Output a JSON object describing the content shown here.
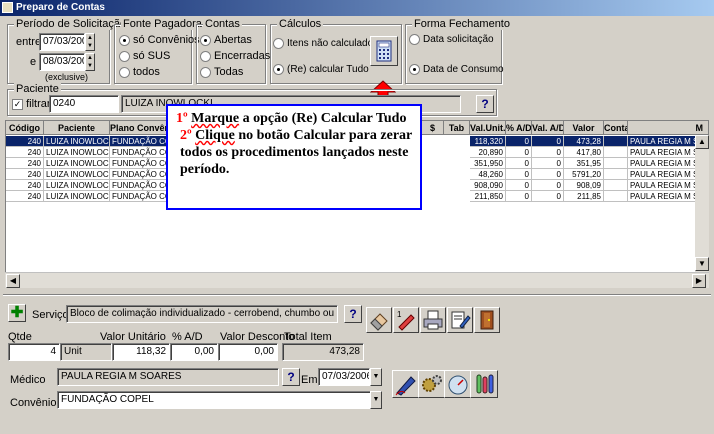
{
  "window": {
    "title": "Preparo de Contas"
  },
  "periodo": {
    "label": "Período de Solicitação",
    "entre_label": "entre",
    "entre_value": "07/03/2006",
    "e_label": "e",
    "e_value": "08/03/2006",
    "exclusive": "(exclusive)"
  },
  "fonte": {
    "label": "Fonte Pagadora",
    "options": [
      "só Convênios",
      "só SUS",
      "todos"
    ],
    "selected": 0
  },
  "contas": {
    "label": "Contas",
    "options": [
      "Abertas",
      "Encerradas",
      "Todas"
    ],
    "selected": 0
  },
  "calculos": {
    "label": "Cálculos",
    "options": [
      "Itens não calculados",
      "(Re) calcular Tudo"
    ],
    "selected": 1
  },
  "fechamento": {
    "label": "Forma Fechamento",
    "options": [
      "Data solicitação",
      "Data de Consumo"
    ],
    "selected": 1
  },
  "paciente": {
    "label": "Paciente",
    "filtrar_label": "filtrar",
    "code": "0240",
    "name": "LUIZA INOWLOCKI",
    "help": "?"
  },
  "grid": {
    "columns": [
      "Código",
      "Paciente",
      "Plano Convênio",
      "$",
      "Tab",
      "Val.Unit.",
      "% A/D",
      "Val. A/D.",
      "Valor",
      "Conta",
      "M"
    ],
    "rows": [
      [
        "240",
        "LUIZA INOWLOCKI",
        "FUNDAÇÃO COPEL",
        "118,320",
        "0",
        "0",
        "473,28",
        "PAULA REGIA M SOARES"
      ],
      [
        "240",
        "LUIZA INOWLOCKI",
        "FUNDAÇÃO COPEL",
        "20,890",
        "0",
        "0",
        "417,80",
        "PAULA REGIA M SOARES"
      ],
      [
        "240",
        "LUIZA INOWLOCKI",
        "FUNDAÇÃO COPEL",
        "351,950",
        "0",
        "0",
        "351,95",
        "PAULA REGIA M SOARES"
      ],
      [
        "240",
        "LUIZA INOWLOCKI",
        "FUNDAÇÃO COPEL",
        "48,260",
        "0",
        "0",
        "5791,20",
        "PAULA REGIA M SOARES"
      ],
      [
        "240",
        "LUIZA INOWLOCKI",
        "FUNDAÇÃO COPEL",
        "908,090",
        "0",
        "0",
        "908,09",
        "PAULA REGIA M SOARES"
      ],
      [
        "240",
        "LUIZA INOWLOCKI",
        "FUNDAÇÃO COPEL",
        "211,850",
        "0",
        "0",
        "211,85",
        "PAULA REGIA M SOARES"
      ]
    ]
  },
  "tooltip": {
    "n1": "1º",
    "w1": "Marque",
    "t1": "a opção (Re) Calcular Tudo",
    "n2": "2º",
    "w2": "Clique",
    "t2": "no botão Calcular para zerar todos os procedimentos lançados neste período."
  },
  "servico": {
    "label": "Serviço:",
    "value": "Bloco de colimação individualizado - cerrobend, chumbo ou multileaf (",
    "help": "?"
  },
  "item": {
    "qtde_label": "Qtde",
    "qtde": "4",
    "unit": "Unit",
    "valor_unit_label": "Valor Unitário",
    "valor_unit": "118,32",
    "ad_label": "% A/D",
    "ad": "0,00",
    "desconto_label": "Valor Desconto",
    "desconto": "0,00",
    "total_label": "Total Item",
    "total": "473,28"
  },
  "medico": {
    "label": "Médico",
    "value": "PAULA REGIA M SOARES",
    "help": "?",
    "em_label": "Em:",
    "em_value": "07/03/2006"
  },
  "convenio": {
    "label": "Convênio:",
    "value": "FUNDAÇÃO COPEL"
  }
}
